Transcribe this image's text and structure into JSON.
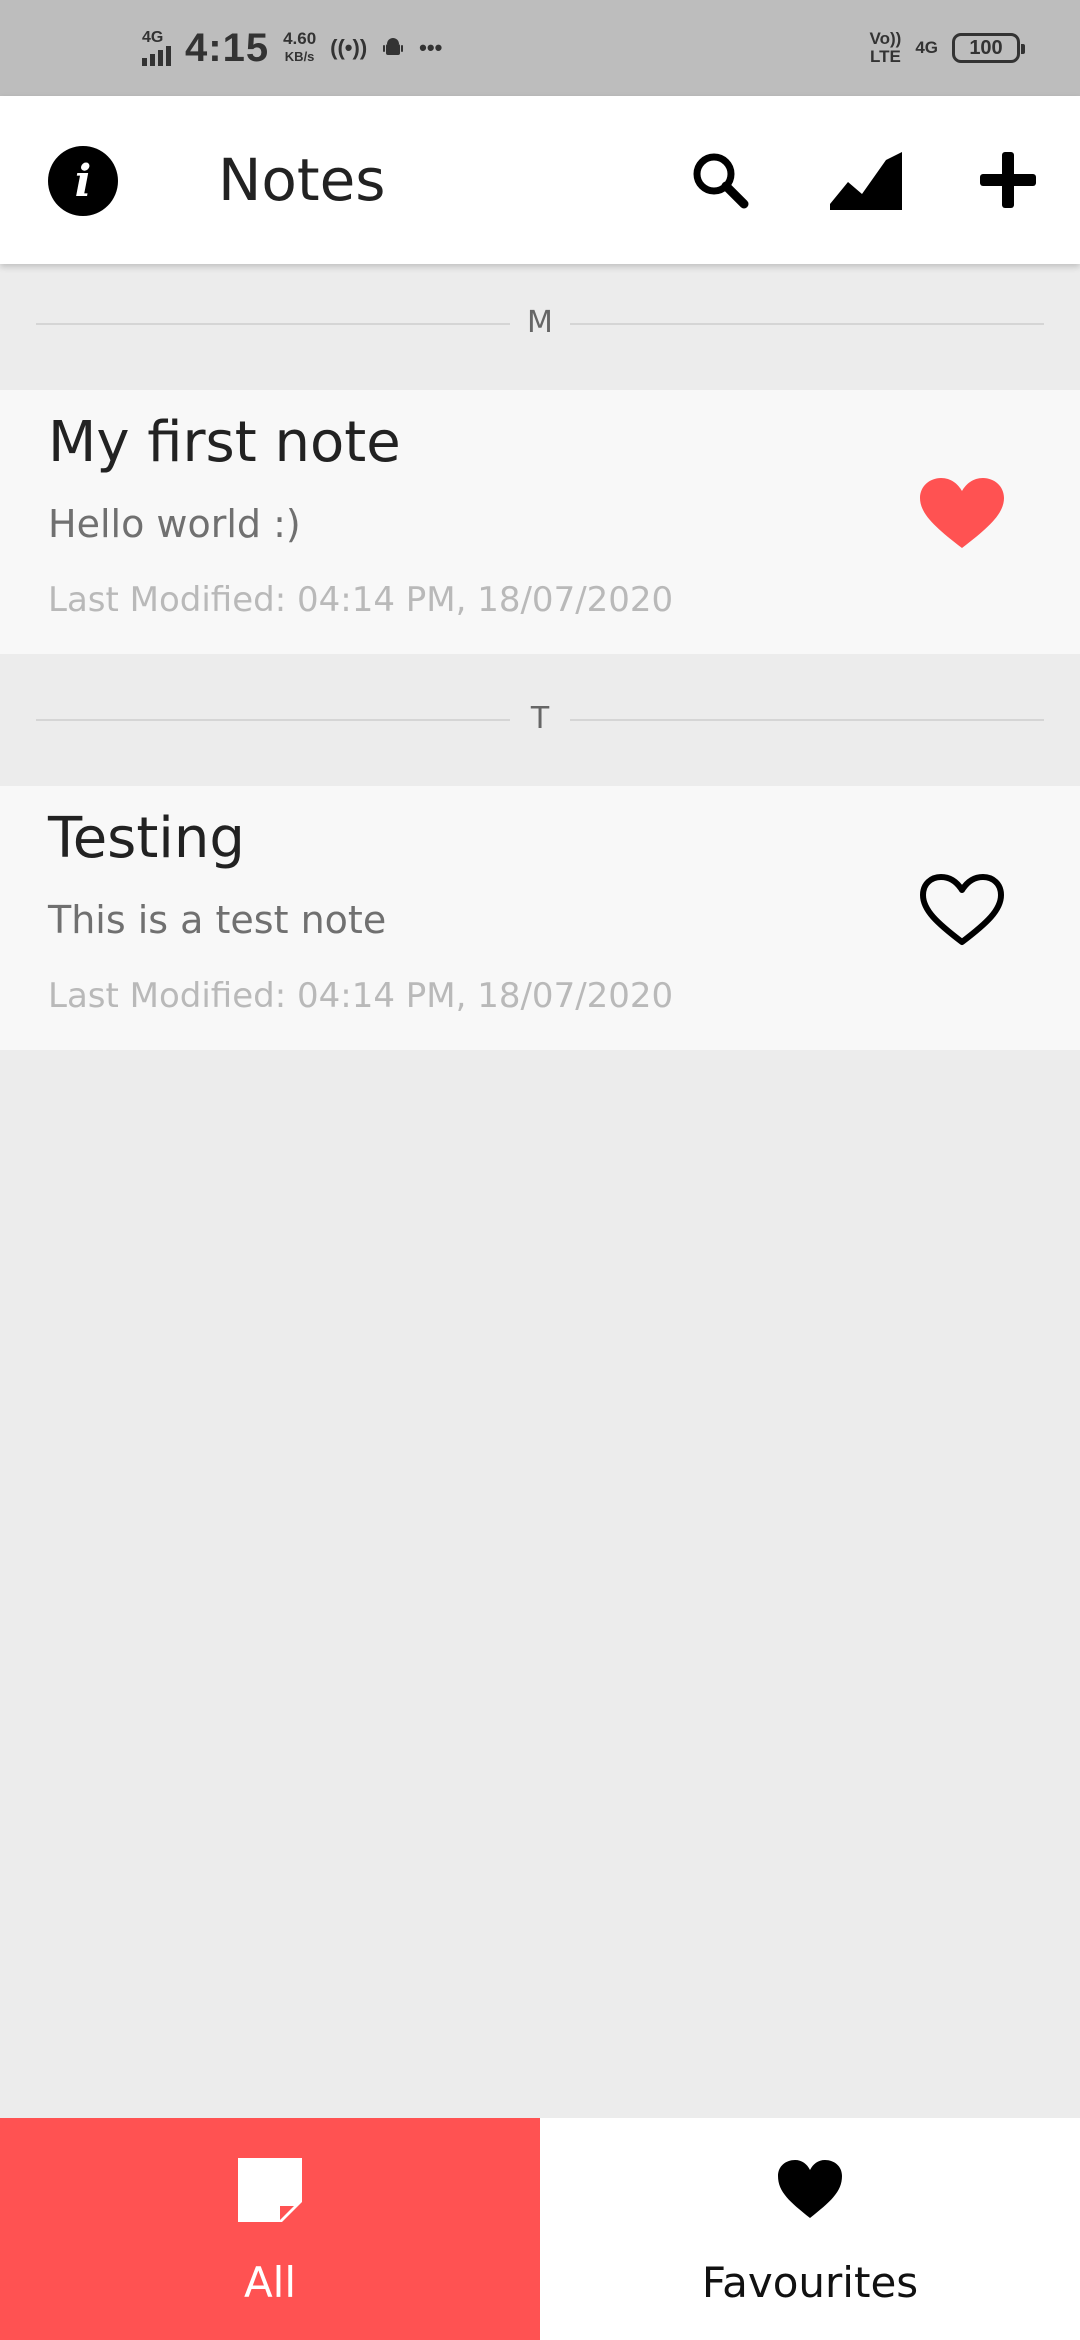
{
  "status_bar": {
    "network": "4G",
    "time": "4:15",
    "speed_value": "4.60",
    "speed_unit": "KB/s",
    "volte": "Vo))",
    "lte": "LTE",
    "network_right": "4G",
    "battery": "100"
  },
  "app_bar": {
    "title": "Notes",
    "icons": [
      "info-icon",
      "search-icon",
      "stats-icon",
      "add-icon"
    ]
  },
  "sections": [
    {
      "letter": "M",
      "notes": [
        {
          "title": "My first note",
          "body": "Hello world :)",
          "meta": "Last Modified: 04:14 PM, 18/07/2020",
          "favourite": true
        }
      ]
    },
    {
      "letter": "T",
      "notes": [
        {
          "title": "Testing",
          "body": "This is a test note",
          "meta": "Last Modified: 04:14 PM, 18/07/2020",
          "favourite": false
        }
      ]
    }
  ],
  "bottom_nav": {
    "tabs": [
      {
        "label": "All",
        "icon": "note-icon",
        "active": true
      },
      {
        "label": "Favourites",
        "icon": "heart-icon",
        "active": false
      }
    ]
  },
  "colors": {
    "accent": "#ff5252",
    "background": "#ececec",
    "card": "#f8f8f8",
    "status_bar": "#bdbdbd"
  }
}
